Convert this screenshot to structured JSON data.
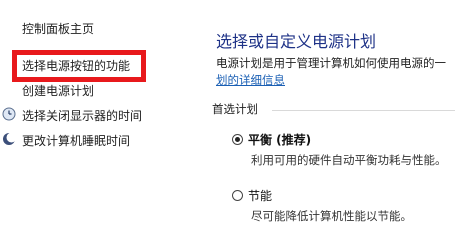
{
  "sidebar": {
    "home": "控制面板主页",
    "items": [
      {
        "label": "选择电源按钮的功能",
        "icon": "none"
      },
      {
        "label": "创建电源计划",
        "icon": "none"
      },
      {
        "label": "选择关闭显示器的时间",
        "icon": "monitor-clock-icon"
      },
      {
        "label": "更改计算机睡眠时间",
        "icon": "moon-sleep-icon"
      }
    ]
  },
  "main": {
    "title": "选择或自定义电源计划",
    "description_line1": "电源计划是用于管理计算机如何使用电源的一",
    "description_link": "划的详细信息",
    "group_label": "首选计划",
    "plans": [
      {
        "name": "平衡 (推荐)",
        "description": "利用可用的硬件自动平衡功耗与性能。",
        "selected": true
      },
      {
        "name": "节能",
        "description": "尽可能降低计算机性能以节能。",
        "selected": false
      }
    ]
  },
  "colors": {
    "highlight": "#e8191c",
    "title": "#1e3287",
    "link": "#1a5fb4"
  }
}
